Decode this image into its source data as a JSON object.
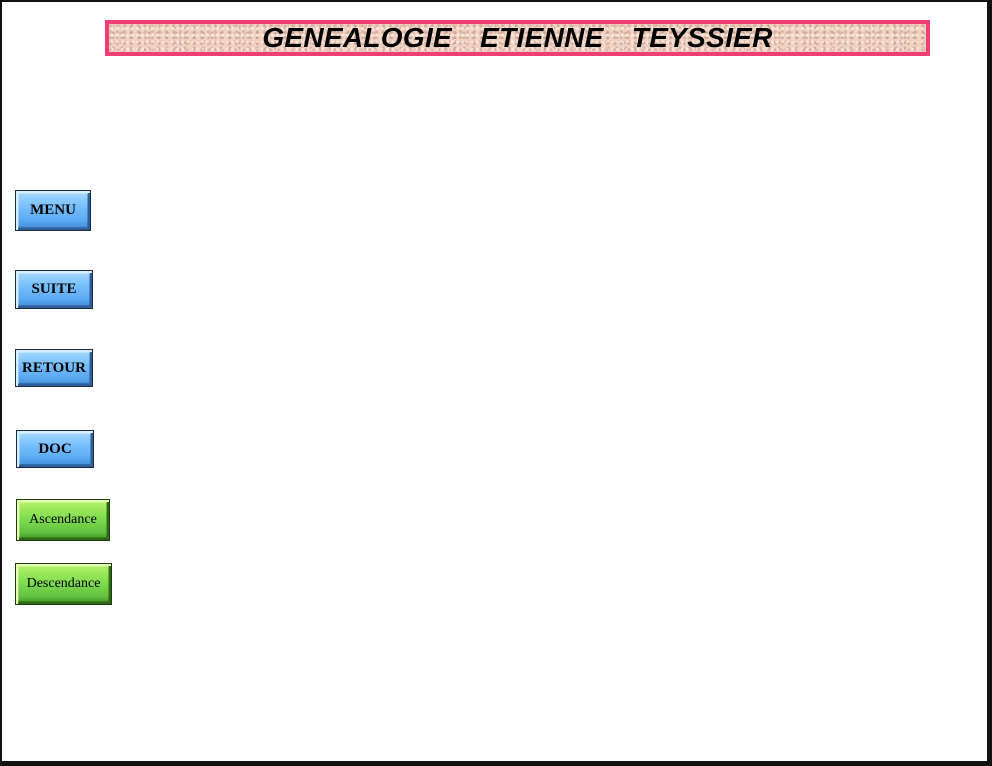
{
  "header": {
    "title": "GENEALOGIE  ETIENNE  TEYSSIER"
  },
  "nav": {
    "menu_label": "MENU",
    "suite_label": "SUITE",
    "retour_label": "RETOUR",
    "doc_label": "DOC",
    "ascendance_label": "Ascendance",
    "descendance_label": "Descendance"
  },
  "colors": {
    "banner_border": "#ef3f72",
    "banner_background": "#efd3c4",
    "blue_button": "#7cc3ff",
    "green_button": "#86e053"
  }
}
